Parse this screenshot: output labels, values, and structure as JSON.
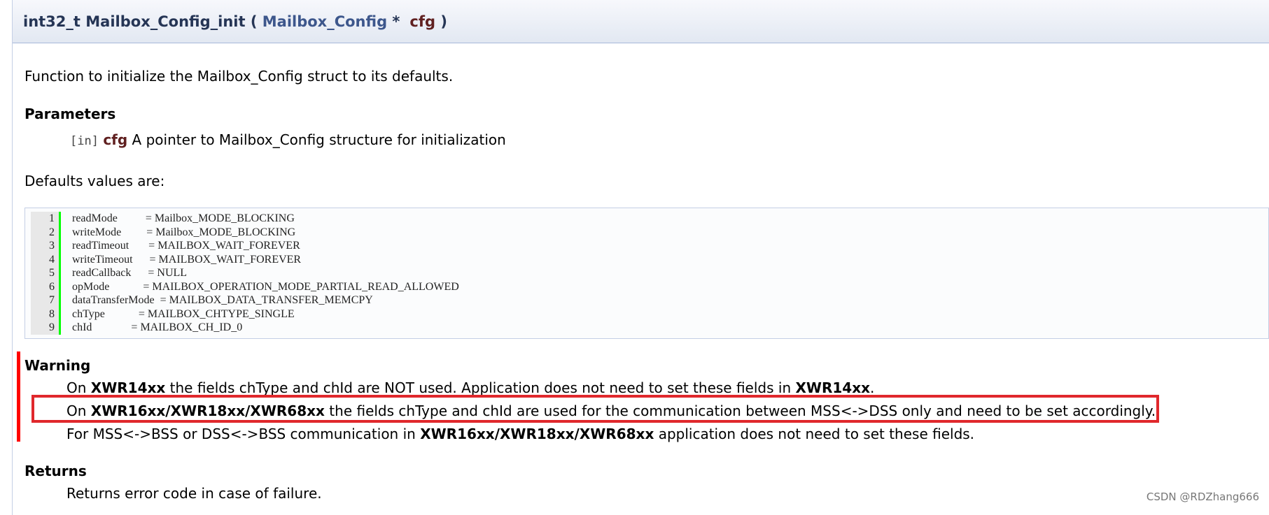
{
  "proto": {
    "ret": "int32_t",
    "name": "Mailbox_Config_init",
    "open": "(",
    "type": "Mailbox_Config",
    "star": "*",
    "param": "cfg",
    "close": ")"
  },
  "description": "Function to initialize the Mailbox_Config struct to its defaults.",
  "params": {
    "heading": "Parameters",
    "dir": "[in]",
    "name": "cfg",
    "desc": "A pointer to Mailbox_Config structure for initialization"
  },
  "defaults_label": "Defaults values are:",
  "code_lines": [
    {
      "no": "1",
      "text": "readMode          = Mailbox_MODE_BLOCKING"
    },
    {
      "no": "2",
      "text": "writeMode         = Mailbox_MODE_BLOCKING"
    },
    {
      "no": "3",
      "text": "readTimeout       = MAILBOX_WAIT_FOREVER"
    },
    {
      "no": "4",
      "text": "writeTimeout      = MAILBOX_WAIT_FOREVER"
    },
    {
      "no": "5",
      "text": "readCallback      = NULL"
    },
    {
      "no": "6",
      "text": "opMode            = MAILBOX_OPERATION_MODE_PARTIAL_READ_ALLOWED"
    },
    {
      "no": "7",
      "text": "dataTransferMode  = MAILBOX_DATA_TRANSFER_MEMCPY"
    },
    {
      "no": "8",
      "text": "chType            = MAILBOX_CHTYPE_SINGLE"
    },
    {
      "no": "9",
      "text": "chId              = MAILBOX_CH_ID_0"
    }
  ],
  "warning": {
    "heading": "Warning",
    "line1": {
      "a": "On",
      "b": "XWR14xx",
      "c": "the fields chType and chId are NOT used. Application does not need to set these fields in",
      "d": "XWR14xx",
      "e": "."
    },
    "line2": {
      "a": "On",
      "b": "XWR16xx/XWR18xx/XWR68xx",
      "c": "the fields chType and chId are used for the communication between MSS<->DSS only and need to be set accordingly."
    },
    "line3": {
      "a": "For MSS<->BSS or DSS<->BSS communication in",
      "b": "XWR16xx/XWR18xx/XWR68xx",
      "c": "application does not need to set these fields."
    }
  },
  "returns": {
    "heading": "Returns",
    "text": "Returns error code in case of failure."
  },
  "watermark": "CSDN @RDZhang666",
  "colors": {
    "highlight_box": "#e0282c",
    "warning_bar": "#ff0000",
    "line_marker": "#00ff00",
    "param_name": "#602020",
    "proto_link": "#3d578c"
  }
}
